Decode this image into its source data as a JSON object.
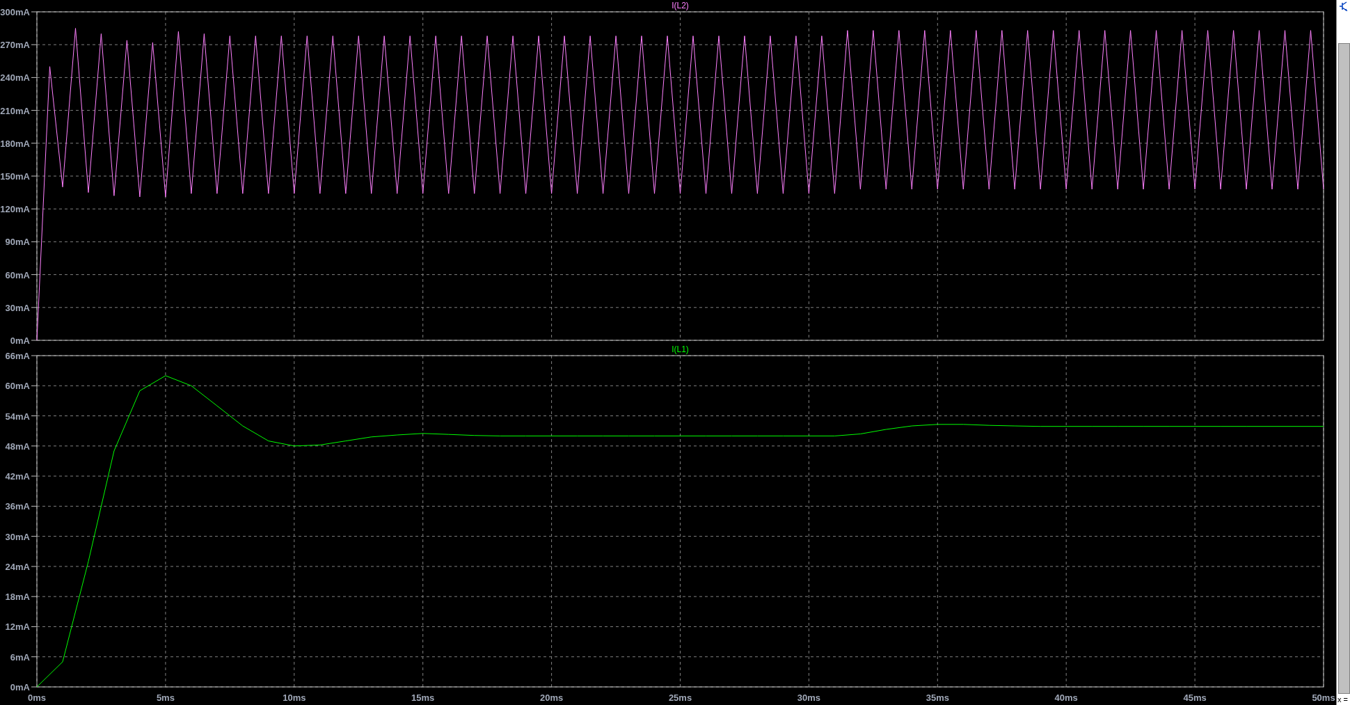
{
  "panes": [
    {
      "chart_data": {
        "type": "line",
        "xlim": [
          0,
          50
        ],
        "ylim": [
          0,
          300
        ],
        "grid": true,
        "yticks": [
          {
            "value": 0,
            "label": "0mA"
          },
          {
            "value": 30,
            "label": "30mA"
          },
          {
            "value": 60,
            "label": "60mA"
          },
          {
            "value": 90,
            "label": "90mA"
          },
          {
            "value": 120,
            "label": "120mA"
          },
          {
            "value": 150,
            "label": "150mA"
          },
          {
            "value": 180,
            "label": "180mA"
          },
          {
            "value": 210,
            "label": "210mA"
          },
          {
            "value": 240,
            "label": "240mA"
          },
          {
            "value": 270,
            "label": "270mA"
          },
          {
            "value": 300,
            "label": "300mA"
          }
        ],
        "x": [
          0,
          0.5,
          1,
          1.5,
          2,
          2.5,
          3,
          3.5,
          4,
          4.5,
          5,
          5.5,
          6,
          6.5,
          7,
          7.5,
          8,
          8.5,
          9,
          9.5,
          10,
          10.5,
          11,
          11.5,
          12,
          12.5,
          13,
          13.5,
          14,
          14.5,
          15,
          15.5,
          16,
          16.5,
          17,
          17.5,
          18,
          18.5,
          19,
          19.5,
          20,
          20.5,
          21,
          21.5,
          22,
          22.5,
          23,
          23.5,
          24,
          24.5,
          25,
          25.5,
          26,
          26.5,
          27,
          27.5,
          28,
          28.5,
          29,
          29.5,
          30,
          30.5,
          31,
          31.5,
          32,
          32.5,
          33,
          33.5,
          34,
          34.5,
          35,
          35.5,
          36,
          36.5,
          37,
          37.5,
          38,
          38.5,
          39,
          39.5,
          40,
          40.5,
          41,
          41.5,
          42,
          42.5,
          43,
          43.5,
          44,
          44.5,
          45,
          45.5,
          46,
          46.5,
          47,
          47.5,
          48,
          48.5,
          49,
          49.5,
          50
        ],
        "series": [
          {
            "name": "I(L2)",
            "color": "#ff80ff",
            "values": [
              0,
              250,
              140,
              285,
              135,
              280,
              132,
              274,
              131,
              272,
              131,
              282,
              134,
              280,
              134,
              278,
              134,
              278,
              134,
              278,
              134,
              278,
              134,
              278,
              134,
              278,
              134,
              278,
              134,
              278,
              134,
              278,
              134,
              278,
              134,
              278,
              134,
              278,
              134,
              278,
              134,
              278,
              134,
              278,
              134,
              278,
              134,
              278,
              134,
              278,
              134,
              278,
              134,
              278,
              134,
              278,
              134,
              278,
              134,
              278,
              134,
              278,
              134,
              283,
              138,
              283,
              138,
              283,
              138,
              283,
              138,
              283,
              138,
              283,
              138,
              283,
              138,
              283,
              138,
              283,
              138,
              283,
              138,
              283,
              138,
              283,
              138,
              283,
              138,
              283,
              138,
              283,
              138,
              283,
              138,
              283,
              138,
              283,
              138,
              283,
              138
            ]
          }
        ]
      }
    },
    {
      "chart_data": {
        "type": "line",
        "xlim": [
          0,
          50
        ],
        "ylim": [
          0,
          66
        ],
        "grid": true,
        "xticks": [
          {
            "value": 0,
            "label": "0ms"
          },
          {
            "value": 5,
            "label": "5ms"
          },
          {
            "value": 10,
            "label": "10ms"
          },
          {
            "value": 15,
            "label": "15ms"
          },
          {
            "value": 20,
            "label": "20ms"
          },
          {
            "value": 25,
            "label": "25ms"
          },
          {
            "value": 30,
            "label": "30ms"
          },
          {
            "value": 35,
            "label": "35ms"
          },
          {
            "value": 40,
            "label": "40ms"
          },
          {
            "value": 45,
            "label": "45ms"
          },
          {
            "value": 50,
            "label": "50ms"
          }
        ],
        "yticks": [
          {
            "value": 0,
            "label": "0mA"
          },
          {
            "value": 6,
            "label": "6mA"
          },
          {
            "value": 12,
            "label": "12mA"
          },
          {
            "value": 18,
            "label": "18mA"
          },
          {
            "value": 24,
            "label": "24mA"
          },
          {
            "value": 30,
            "label": "30mA"
          },
          {
            "value": 36,
            "label": "36mA"
          },
          {
            "value": 42,
            "label": "42mA"
          },
          {
            "value": 48,
            "label": "48mA"
          },
          {
            "value": 54,
            "label": "54mA"
          },
          {
            "value": 60,
            "label": "60mA"
          },
          {
            "value": 66,
            "label": "66mA"
          }
        ],
        "x": [
          0,
          1,
          2,
          3,
          4,
          5,
          6,
          7,
          8,
          9,
          10,
          11,
          12,
          13,
          14,
          15,
          16,
          17,
          18,
          19,
          20,
          21,
          22,
          23,
          24,
          25,
          26,
          27,
          28,
          29,
          30,
          31,
          32,
          33,
          34,
          35,
          36,
          37,
          38,
          39,
          40,
          41,
          42,
          43,
          44,
          45,
          46,
          47,
          48,
          49,
          50
        ],
        "series": [
          {
            "name": "I(L1)",
            "color": "#00ff00",
            "values": [
              0,
              5,
              25,
              47,
              59,
              62,
              60,
              56,
              52,
              49,
              48,
              48.2,
              49,
              49.8,
              50.2,
              50.5,
              50.3,
              50.1,
              50,
              50,
              50,
              50,
              50,
              50,
              50,
              50,
              50,
              50,
              50,
              50,
              50,
              50,
              50.4,
              51.3,
              52,
              52.3,
              52.3,
              52.1,
              52,
              51.9,
              51.9,
              51.9,
              51.9,
              51.9,
              51.9,
              51.9,
              51.9,
              51.9,
              51.9,
              51.9,
              51.9
            ]
          }
        ]
      }
    }
  ],
  "side_panel": {
    "cursor_readout": "x ="
  }
}
